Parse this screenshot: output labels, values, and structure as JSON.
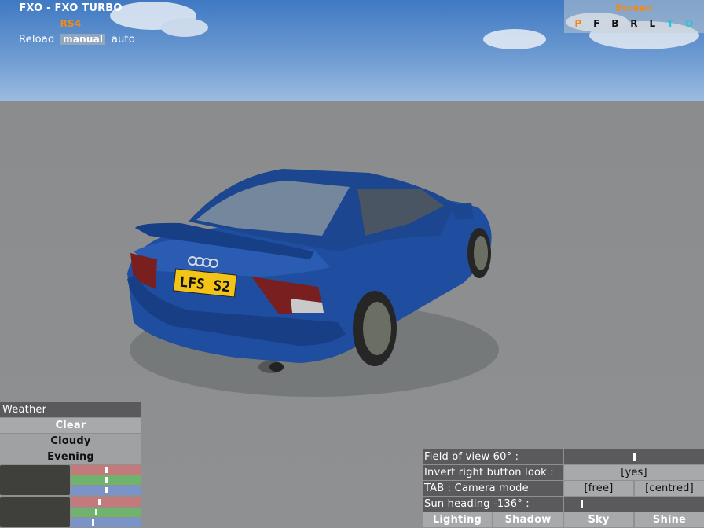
{
  "car_panel": {
    "title": "FXO - FXO TURBO",
    "subtitle": "RS4",
    "reload": "Reload",
    "manual": "manual",
    "auto": "auto"
  },
  "screen_panel": {
    "title": "Screen",
    "letters": [
      "P",
      "F",
      "B",
      "R",
      "L",
      "T",
      "O"
    ]
  },
  "car": {
    "plate": "LFS S2",
    "body_color": "#1f4ea0"
  },
  "weather": {
    "header": "Weather",
    "options": [
      "Clear",
      "Cloudy",
      "Evening"
    ],
    "slider_colors": [
      "#c47a7a",
      "#6fb36f",
      "#7a93c9"
    ],
    "block1_levels": [
      0.5,
      0.5,
      0.5
    ],
    "block2_levels": [
      0.4,
      0.35,
      0.3
    ]
  },
  "camera": {
    "fov_label": "Field of view 60° :",
    "fov_level": 0.5,
    "invert_label": "Invert right button look :",
    "invert_value": "[yes]",
    "tab_label": "TAB : Camera mode",
    "mode_free": "[free]",
    "mode_centred": "[centred]",
    "sun_label": "Sun heading -136° :",
    "sun_level": 0.12,
    "buttons": [
      "Lighting",
      "Shadow",
      "Sky",
      "Shine"
    ]
  },
  "colors": {
    "accent_orange": "#f08a1a",
    "accent_cyan": "#2ac4d8",
    "panel_dark": "#5a5a5c",
    "panel_light": "#a7a9ab"
  }
}
